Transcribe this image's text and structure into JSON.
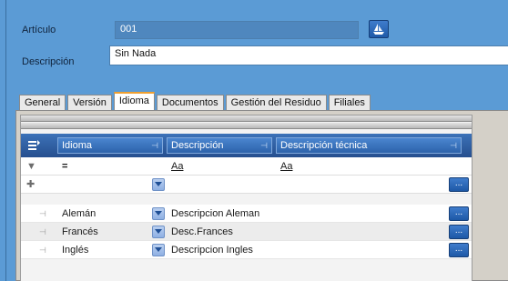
{
  "form": {
    "articulo_label": "Artículo",
    "articulo_value": "001",
    "descripcion_label": "Descripción",
    "descripcion_value": "Sin Nada"
  },
  "tabs": [
    {
      "label": "General"
    },
    {
      "label": "Versión"
    },
    {
      "label": "Idioma",
      "active": true
    },
    {
      "label": "Documentos"
    },
    {
      "label": "Gestión del Residuo"
    },
    {
      "label": "Filiales"
    }
  ],
  "grid": {
    "columns": [
      {
        "label": "Idioma"
      },
      {
        "label": "Descripción"
      },
      {
        "label": "Descripción técnica"
      }
    ],
    "filter": {
      "idioma": "=",
      "descripcion": "Aa",
      "tecnica": "Aa"
    },
    "rows": [
      {
        "idioma": "Alemán",
        "descripcion": "Descripcion Aleman",
        "tecnica": ""
      },
      {
        "idioma": "Francés",
        "descripcion": "Desc.Frances",
        "tecnica": ""
      },
      {
        "idioma": "Inglés",
        "descripcion": "Descripcion Ingles",
        "tecnica": ""
      }
    ],
    "ellipsis_label": "..."
  },
  "colors": {
    "background": "#5b9bd5",
    "header_blue": "#2d63ab",
    "active_tab_accent": "#f0a030"
  }
}
